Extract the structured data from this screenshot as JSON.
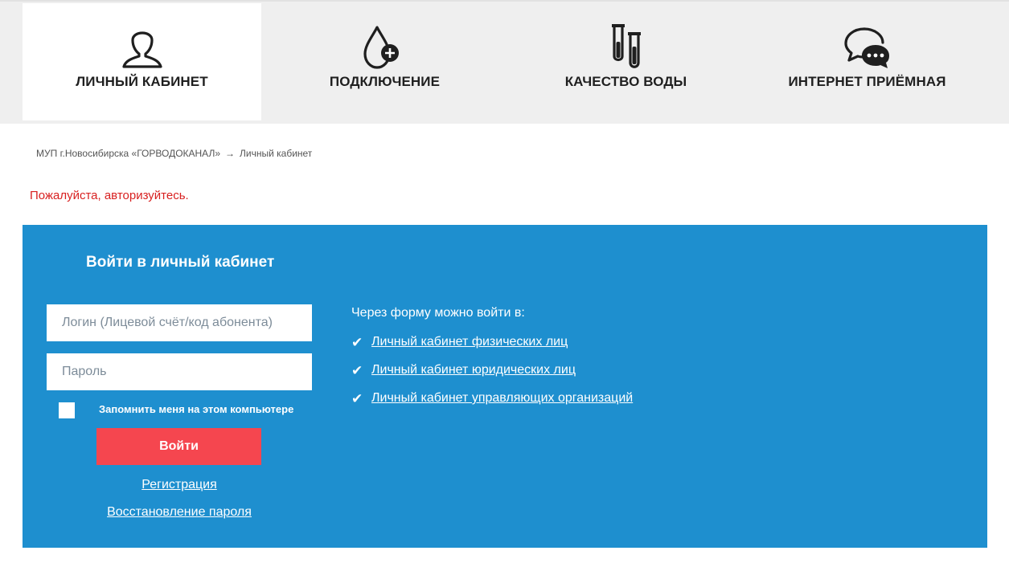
{
  "nav": [
    {
      "label": "Личный кабинет",
      "icon": "user-icon",
      "active": true
    },
    {
      "label": "Подключение",
      "icon": "water-drop-plus-icon",
      "active": false
    },
    {
      "label": "Качество воды",
      "icon": "test-tubes-icon",
      "active": false
    },
    {
      "label": "Интернет приёмная",
      "icon": "chat-bubbles-icon",
      "active": false
    }
  ],
  "breadcrumb": {
    "home": "МУП г.Новосибирска «ГОРВОДОКАНАЛ»",
    "separator": "→",
    "current": "Личный кабинет"
  },
  "alert": "Пожалуйста, авторизуйтесь.",
  "login": {
    "title": "Войти в личный кабинет",
    "login_placeholder": "Логин (Лицевой счёт/код абонента)",
    "login_value": "",
    "password_placeholder": "Пароль",
    "password_value": "",
    "remember_label": "Запомнить меня на этом компьютере",
    "remember_checked": false,
    "submit_label": "Войти",
    "register_link": "Регистрация",
    "restore_link": "Восстановление пароля"
  },
  "info": {
    "title": "Через форму можно войти в:",
    "links": [
      "Личный кабинет физических лиц",
      "Личный кабинет юридических лиц",
      "Личный кабинет управляющих организаций"
    ]
  },
  "colors": {
    "panel": "#1e8fcf",
    "button": "#f5464f",
    "alert": "#d82020",
    "nav_bg": "#efefef"
  }
}
